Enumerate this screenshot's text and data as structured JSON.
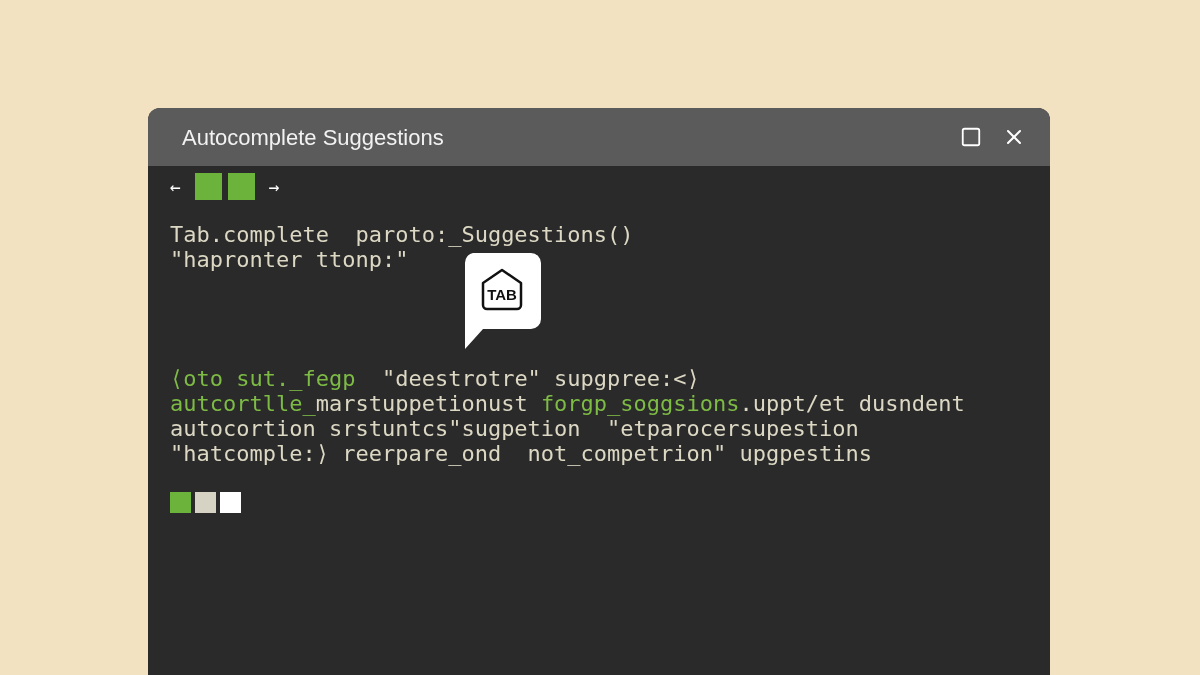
{
  "window": {
    "title": "Autocomplete Suggestions"
  },
  "nav": {
    "back": "←",
    "forward": "→",
    "blocks": [
      {
        "color": "#6bb33a"
      },
      {
        "color": "#6bb33a"
      }
    ]
  },
  "code_top": [
    [
      {
        "text": "Tab.complete  paroto:_Suggestions()",
        "kind": "plain"
      }
    ],
    [
      {
        "text": "\"hapronter ttonp:\"",
        "kind": "plain"
      }
    ]
  ],
  "tab_hint": {
    "label": "TAB"
  },
  "code_bottom": [
    [
      {
        "text": "⟨oto sut._fegp",
        "kind": "green"
      },
      {
        "text": "  \"deestrotre\" supgpree:<⟩",
        "kind": "plain"
      }
    ],
    [
      {
        "text": "autcortlle_",
        "kind": "green"
      },
      {
        "text": "marstuppetionust ",
        "kind": "plain"
      },
      {
        "text": "forgp_soggsions",
        "kind": "green"
      },
      {
        "text": ".uppt/et dusndent",
        "kind": "plain"
      }
    ],
    [
      {
        "text": "autocortion srstuntcs\"sugpetion  \"etparocersupestion",
        "kind": "plain"
      }
    ],
    [
      {
        "text": "\"hatcomple:⟩ reerpare_ond  not_competrion\" upgpestins",
        "kind": "plain"
      }
    ]
  ],
  "status_blocks": [
    {
      "color": "#6bb33a"
    },
    {
      "color": "#d6d2c4"
    },
    {
      "color": "#ffffff"
    }
  ]
}
